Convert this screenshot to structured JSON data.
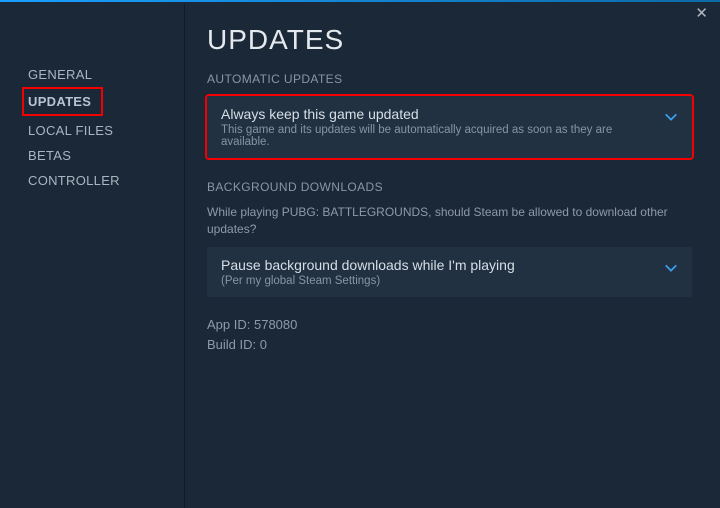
{
  "sidebar": {
    "items": [
      {
        "label": "GENERAL"
      },
      {
        "label": "UPDATES"
      },
      {
        "label": "LOCAL FILES"
      },
      {
        "label": "BETAS"
      },
      {
        "label": "CONTROLLER"
      }
    ]
  },
  "page": {
    "title": "UPDATES",
    "close_glyph": "✕"
  },
  "automatic": {
    "heading": "AUTOMATIC UPDATES",
    "selected": "Always keep this game updated",
    "description": "This game and its updates will be automatically acquired as soon as they are available."
  },
  "background": {
    "heading": "BACKGROUND DOWNLOADS",
    "question": "While playing PUBG: BATTLEGROUNDS, should Steam be allowed to download other updates?",
    "selected": "Pause background downloads while I'm playing",
    "sub": "(Per my global Steam Settings)"
  },
  "info": {
    "app_id_label": "App ID:",
    "app_id": "578080",
    "build_id_label": "Build ID:",
    "build_id": "0"
  }
}
